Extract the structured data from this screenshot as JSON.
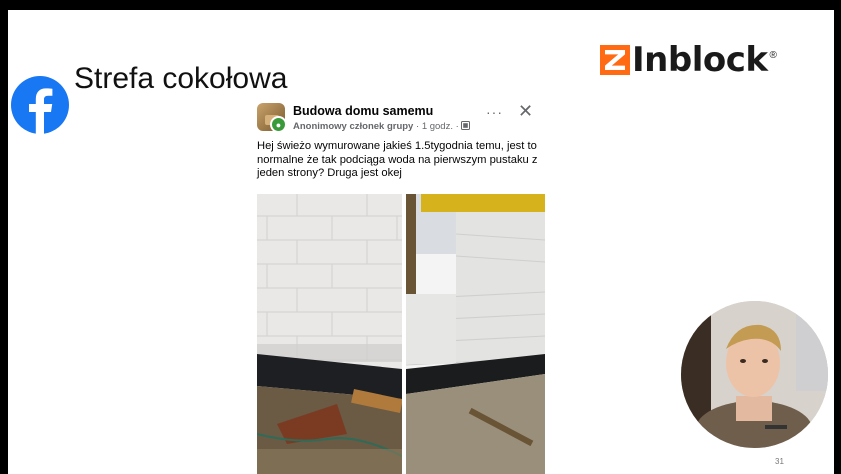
{
  "slide": {
    "title": "Strefa cokołowa",
    "page_number": "31"
  },
  "brand": {
    "name": "Inblock",
    "registered_mark": "®",
    "accent_color": "#ff6a13"
  },
  "facebook": {
    "icon": "facebook-icon",
    "color": "#1877f2"
  },
  "post": {
    "group_name": "Budowa domu samemu",
    "author": "Anonimowy członek grupy",
    "time": "1 godz.",
    "separator": "·",
    "more_icon": "···",
    "close_icon": "✕",
    "text": "Hej świeżo wymurowane jakieś 1.5tygodnia temu, jest to normalne że tak podciąga woda na pierwszym pustaku z jeden strony? Druga jest okej"
  }
}
